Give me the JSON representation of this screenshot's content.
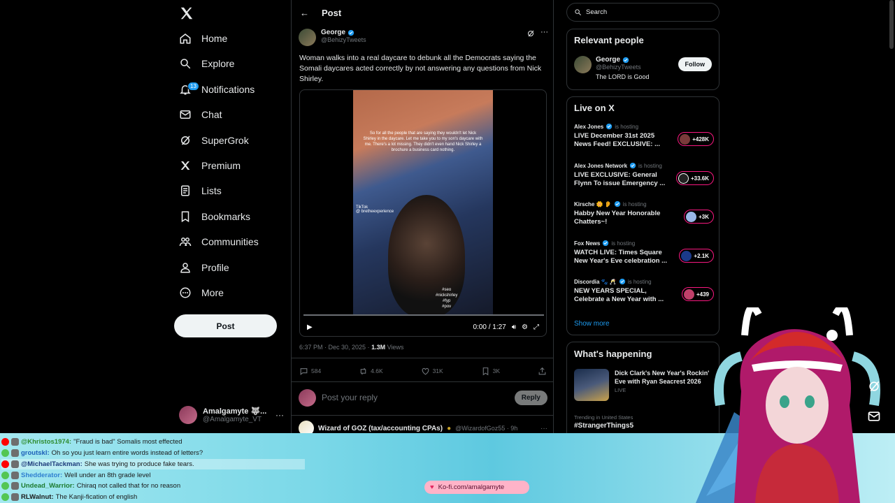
{
  "nav": {
    "items": [
      {
        "label": "Home",
        "icon": "home-icon"
      },
      {
        "label": "Explore",
        "icon": "search-icon"
      },
      {
        "label": "Notifications",
        "icon": "bell-icon",
        "badge": "13"
      },
      {
        "label": "Chat",
        "icon": "mail-icon"
      },
      {
        "label": "SuperGrok",
        "icon": "grok-icon"
      },
      {
        "label": "Premium",
        "icon": "x-logo-icon"
      },
      {
        "label": "Lists",
        "icon": "list-icon"
      },
      {
        "label": "Bookmarks",
        "icon": "bookmark-icon"
      },
      {
        "label": "Communities",
        "icon": "people-icon"
      },
      {
        "label": "Profile",
        "icon": "person-icon"
      },
      {
        "label": "More",
        "icon": "more-circle-icon"
      }
    ],
    "post_label": "Post",
    "account": {
      "name": "Amalgamyte 🐺...",
      "handle": "@Amalgamyte_VT"
    }
  },
  "header": {
    "title": "Post"
  },
  "tweet": {
    "author_name": "George",
    "author_handle": "@BehizyTweets",
    "text": "Woman walks into a real daycare to debunk all the Democrats saying the Somali daycares acted correctly by not answering any questions from Nick Shirley.",
    "video": {
      "caption": "So for all the people that are saying they wouldn't let Nick Shirley in the daycare. Let me take you to my son's daycare with me. There's a lot missing. They didn't even hand Nick Shirley a brochure a business card nothing.",
      "tiktok": "TikTok",
      "tiktok_handle": "@ bretheexperience",
      "hashtags": [
        "#seo",
        "#nickshirley",
        "#fyp",
        "#pov"
      ],
      "time": "0:00 / 1:27"
    },
    "timestamp": "6:37 PM · Dec 30, 2025 · ",
    "views": "1.3M",
    "views_label": " Views",
    "replies": "584",
    "reposts": "4.6K",
    "likes": "31K",
    "bookmarks": "3K"
  },
  "reply": {
    "placeholder": "Post your reply",
    "button": "Reply"
  },
  "next_tweet": {
    "name": "Wizard of GOZ (tax/accounting CPAs)",
    "handle": "@WizardofGoz55 · 9h"
  },
  "search": {
    "placeholder": "Search"
  },
  "relevant": {
    "title": "Relevant people",
    "name": "George",
    "handle": "@BehizyTweets",
    "bio": "The LORD is Good",
    "follow": "Follow"
  },
  "live": {
    "title": "Live on X",
    "hosting": "is hosting",
    "items": [
      {
        "host": "Alex Jones",
        "title": "LIVE December 31st 2025 News Feed! EXCLUSIVE: ...",
        "count": "+428K",
        "color": "#7a3a3a"
      },
      {
        "host": "Alex Jones Network",
        "title": "LIVE EXCLUSIVE: General Flynn To issue Emergency ...",
        "count": "+33.6K",
        "color": "#222222"
      },
      {
        "host": "Kirsche 🌼 👂",
        "title": "Habby New Year Honorable Chatters~!",
        "count": "+3K",
        "color": "#9ab8e8"
      },
      {
        "host": "Fox News",
        "title": "WATCH LIVE: Times Square New Year's Eve celebration ...",
        "count": "+2.1K",
        "color": "#1b3a8a"
      },
      {
        "host": "Discordia 🐾 🥂",
        "title": "NEW YEARS SPECIAL, Celebrate a New Year with ...",
        "count": "+439",
        "color": "#c0406a"
      }
    ],
    "show_more": "Show more"
  },
  "happening": {
    "title": "What's happening",
    "item_title": "Dick Clark's New Year's Rockin' Eve with Ryan Seacrest 2026",
    "item_sub": "LIVE",
    "trend_label": "Trending in United States",
    "trend_name": "#StrangerThings5"
  },
  "chat": [
    {
      "user": "@Khristos1974:",
      "msg": "\"Fraud is bad\" Somalis most effected",
      "user_color": "#2e8b2e",
      "platform": "#ff0000"
    },
    {
      "user": "groutskl:",
      "msg": "Oh so you just learn entire words instead of letters?",
      "user_color": "#1c5fb8",
      "platform": "#53c653"
    },
    {
      "user": "@MichaelTackman:",
      "msg": "She was trying to produce fake tears.",
      "user_color": "#1c3a7a",
      "platform": "#ff0000"
    },
    {
      "user": "Shedderator:",
      "msg": "Well under an 8th grade level",
      "user_color": "#2f7fd0",
      "platform": "#53c653"
    },
    {
      "user": "Undead_Warrior:",
      "msg": "Chiraq not called that for no reason",
      "user_color": "#1c7a2e",
      "platform": "#53c653"
    },
    {
      "user": "RLWalnut:",
      "msg": "The Kanji-fication of english",
      "user_color": "#1a1a1a",
      "platform": "#53c653"
    }
  ],
  "kofi": "Ko-fi.com/amalgamyte",
  "colors": {
    "accent": "#1d9bf0",
    "live": "#f91880",
    "bg": "#000000",
    "chat_band": "#7bd8e8"
  }
}
